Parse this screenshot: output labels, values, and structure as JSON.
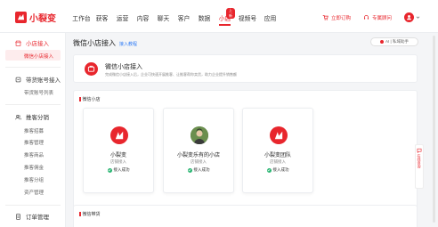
{
  "app": {
    "name": "小裂变",
    "brand_color": "#e8262d"
  },
  "nav": [
    {
      "label": "工作台"
    },
    {
      "label": "获客"
    },
    {
      "label": "运营"
    },
    {
      "label": "内容"
    },
    {
      "label": "聊天"
    },
    {
      "label": "客户"
    },
    {
      "label": "数据"
    },
    {
      "label": "小店",
      "active": true,
      "badge": "上新"
    },
    {
      "label": "视频号"
    },
    {
      "label": "应用"
    }
  ],
  "topbar": {
    "order_label": "立即订购",
    "support_label": "专属顾问"
  },
  "sidebar": {
    "groups": [
      {
        "label": "小店接入",
        "icon": "shop-icon",
        "active": true,
        "items": [
          {
            "label": "微信小店接入",
            "active": true
          }
        ]
      },
      {
        "label": "带货账号接入",
        "icon": "account-icon",
        "items": [
          {
            "label": "带货账号列表"
          }
        ]
      },
      {
        "label": "推客分销",
        "icon": "users-icon",
        "items": [
          {
            "label": "推客招募"
          },
          {
            "label": "推客管理"
          },
          {
            "label": "推客商品"
          },
          {
            "label": "推客佣金"
          },
          {
            "label": "推客分组"
          },
          {
            "label": "资产管理"
          }
        ]
      },
      {
        "label": "订单管理",
        "icon": "order-icon",
        "items": []
      }
    ]
  },
  "page": {
    "title": "微信小店接入",
    "help_link": "接入教程",
    "ai_button": "AI | 私域助手",
    "intro": {
      "title": "微信小店接入",
      "desc": "完成微信小店接入后，企业可快速开展推客、让推客帮你卖货，助力企业提升销售额"
    },
    "section_title": "微信小店",
    "section2_title": "微信带货",
    "stores": [
      {
        "name": "小裂变",
        "role": "店铺接入",
        "status": "接入成功",
        "type": "logo"
      },
      {
        "name": "小裂变乐有的小店",
        "role": "店铺接入",
        "status": "接入成功",
        "type": "photo"
      },
      {
        "name": "小裂变团队",
        "role": "店铺接入",
        "status": "接入成功",
        "type": "logo"
      }
    ]
  },
  "float_bar": {
    "label": "在线咨询"
  }
}
